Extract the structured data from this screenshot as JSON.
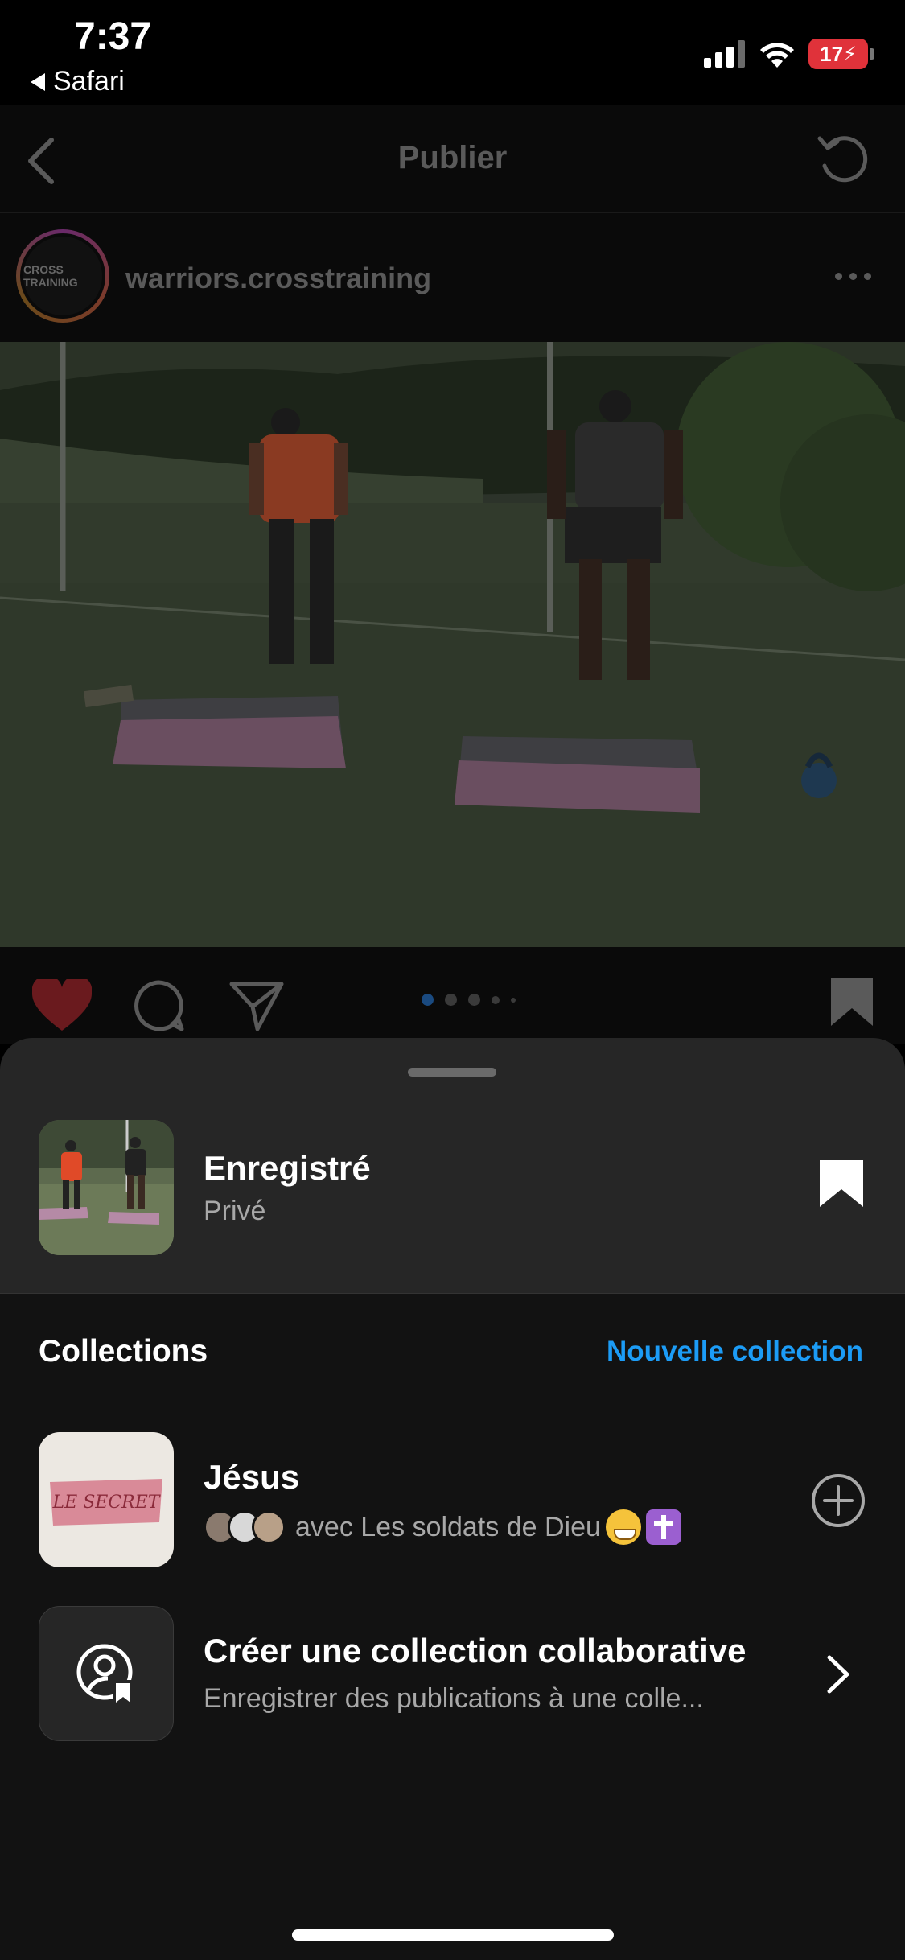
{
  "status_bar": {
    "time": "7:37",
    "back_app": "Safari",
    "battery": "17"
  },
  "header": {
    "title": "Publier"
  },
  "post": {
    "username": "warriors.crosstraining",
    "avatar_text": "CROSS TRAINING",
    "carousel": {
      "count": 5,
      "active_index": 0
    }
  },
  "sheet": {
    "saved": {
      "title": "Enregistré",
      "subtitle": "Privé"
    },
    "collections_header": "Collections",
    "new_collection_label": "Nouvelle collection",
    "collections": [
      {
        "title": "Jésus",
        "subtitle": "avec Les soldats de Dieu",
        "thumb_text": "LE SECRET"
      }
    ],
    "collab": {
      "title": "Créer une collection collaborative",
      "subtitle": "Enregistrer des publications à une colle..."
    }
  },
  "colors": {
    "accent": "#1c9cf6",
    "like": "#e0323a",
    "sheet_bg": "#121212",
    "sheet_top_bg": "#262626"
  },
  "icons": {
    "nav_back": "chevron-left-icon",
    "refresh": "refresh-icon",
    "like": "heart-icon",
    "comment": "comment-icon",
    "share": "paper-plane-icon",
    "save": "bookmark-icon",
    "add": "plus-circle-icon",
    "collab": "person-bookmark-icon",
    "open": "chevron-right-icon"
  }
}
